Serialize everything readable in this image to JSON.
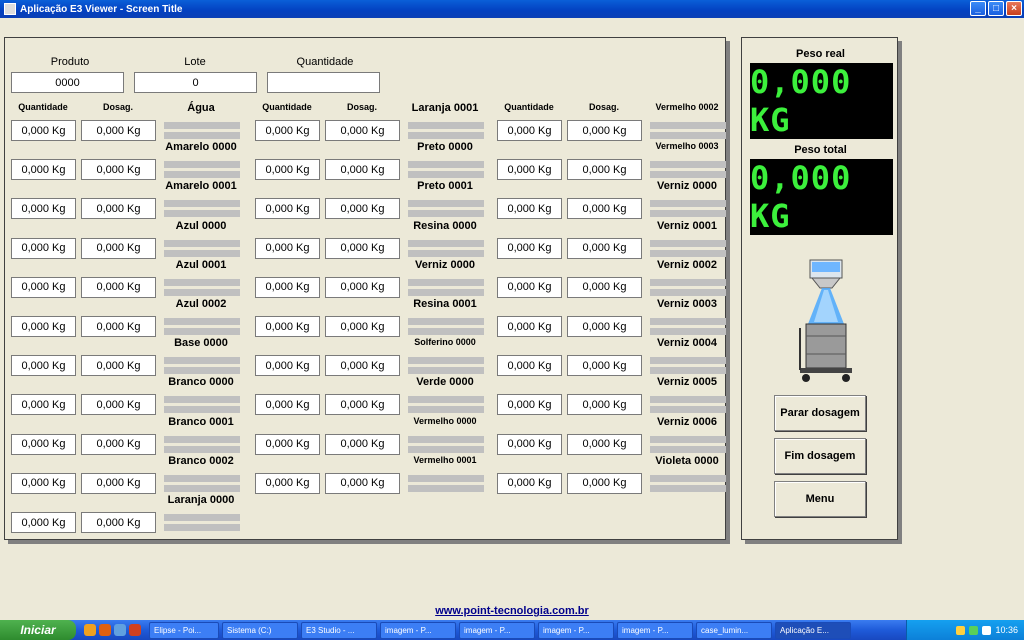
{
  "window": {
    "title": "Aplicação E3 Viewer - Screen Title",
    "buttons": [
      "_",
      "□",
      "×"
    ]
  },
  "header": {
    "produto_label": "Produto",
    "produto_value": "0000",
    "lote_label": "Lote",
    "lote_value": "0",
    "quantidade_label": "Quantidade",
    "quantidade_value": ""
  },
  "columns": [
    {
      "qty_header": "Quantidade",
      "dos_header": "Dosag.",
      "rows": [
        {
          "name": "Água",
          "qty": "0,000 Kg",
          "dos": "0,000 Kg"
        },
        {
          "name": "Amarelo 0000",
          "qty": "0,000 Kg",
          "dos": "0,000 Kg"
        },
        {
          "name": "Amarelo 0001",
          "qty": "0,000 Kg",
          "dos": "0,000 Kg"
        },
        {
          "name": "Azul 0000",
          "qty": "0,000 Kg",
          "dos": "0,000 Kg"
        },
        {
          "name": "Azul 0001",
          "qty": "0,000 Kg",
          "dos": "0,000 Kg"
        },
        {
          "name": "Azul 0002",
          "qty": "0,000 Kg",
          "dos": "0,000 Kg"
        },
        {
          "name": "Base 0000",
          "qty": "0,000 Kg",
          "dos": "0,000 Kg"
        },
        {
          "name": "Branco 0000",
          "qty": "0,000 Kg",
          "dos": "0,000 Kg"
        },
        {
          "name": "Branco 0001",
          "qty": "0,000 Kg",
          "dos": "0,000 Kg"
        },
        {
          "name": "Branco 0002",
          "qty": "0,000 Kg",
          "dos": "0,000 Kg"
        },
        {
          "name": "Laranja 0000",
          "qty": "0,000 Kg",
          "dos": "0,000 Kg"
        }
      ]
    },
    {
      "qty_header": "Quantidade",
      "dos_header": "Dosag.",
      "rows": [
        {
          "name": "Laranja 0001",
          "qty": "0,000 Kg",
          "dos": "0,000 Kg"
        },
        {
          "name": "Preto 0000",
          "qty": "0,000 Kg",
          "dos": "0,000 Kg"
        },
        {
          "name": "Preto 0001",
          "qty": "0,000 Kg",
          "dos": "0,000 Kg"
        },
        {
          "name": "Resina 0000",
          "qty": "0,000 Kg",
          "dos": "0,000 Kg"
        },
        {
          "name": "Verniz 0000",
          "qty": "0,000 Kg",
          "dos": "0,000 Kg"
        },
        {
          "name": "Resina 0001",
          "qty": "0,000 Kg",
          "dos": "0,000 Kg"
        },
        {
          "name": "Solferino 0000",
          "qty": "0,000 Kg",
          "dos": "0,000 Kg",
          "small": true
        },
        {
          "name": "Verde 0000",
          "qty": "0,000 Kg",
          "dos": "0,000 Kg"
        },
        {
          "name": "Vermelho 0000",
          "qty": "0,000 Kg",
          "dos": "0,000 Kg",
          "small": true
        },
        {
          "name": "Vermelho 0001",
          "qty": "0,000 Kg",
          "dos": "0,000 Kg",
          "small": true
        }
      ]
    },
    {
      "qty_header": "Quantidade",
      "dos_header": "Dosag.",
      "rows": [
        {
          "name": "Vermelho 0002",
          "qty": "0,000 Kg",
          "dos": "0,000 Kg",
          "small": true
        },
        {
          "name": "Vermelho 0003",
          "qty": "0,000 Kg",
          "dos": "0,000 Kg",
          "small": true
        },
        {
          "name": "Verniz 0000",
          "qty": "0,000 Kg",
          "dos": "0,000 Kg"
        },
        {
          "name": "Verniz 0001",
          "qty": "0,000 Kg",
          "dos": "0,000 Kg"
        },
        {
          "name": "Verniz 0002",
          "qty": "0,000 Kg",
          "dos": "0,000 Kg"
        },
        {
          "name": "Verniz 0003",
          "qty": "0,000 Kg",
          "dos": "0,000 Kg"
        },
        {
          "name": "Verniz 0004",
          "qty": "0,000 Kg",
          "dos": "0,000 Kg"
        },
        {
          "name": "Verniz 0005",
          "qty": "0,000 Kg",
          "dos": "0,000 Kg"
        },
        {
          "name": "Verniz 0006",
          "qty": "0,000 Kg",
          "dos": "0,000 Kg"
        },
        {
          "name": "Violeta 0000",
          "qty": "0,000 Kg",
          "dos": "0,000 Kg"
        }
      ]
    }
  ],
  "side": {
    "peso_real_label": "Peso real",
    "peso_real_value": "0,000 KG",
    "peso_total_label": "Peso total",
    "peso_total_value": "0,000 KG",
    "btn_parar": "Parar dosagem",
    "btn_fim": "Fim dosagem",
    "btn_menu": "Menu"
  },
  "footer": {
    "link": "www.point-tecnologia.com.br"
  },
  "taskbar": {
    "start": "Iniciar",
    "tasks": [
      "Elipse - Poi...",
      "Sistema (C:)",
      "E3 Studio - ...",
      "imagem - P...",
      "imagem - P...",
      "imagem - P...",
      "imagem - P...",
      "case_lumin...",
      "Aplicação E..."
    ],
    "clock": "10:36"
  },
  "colors": {
    "display_bg": "#000000",
    "display_text": "#3cf03c",
    "panel": "#ece9d8"
  }
}
